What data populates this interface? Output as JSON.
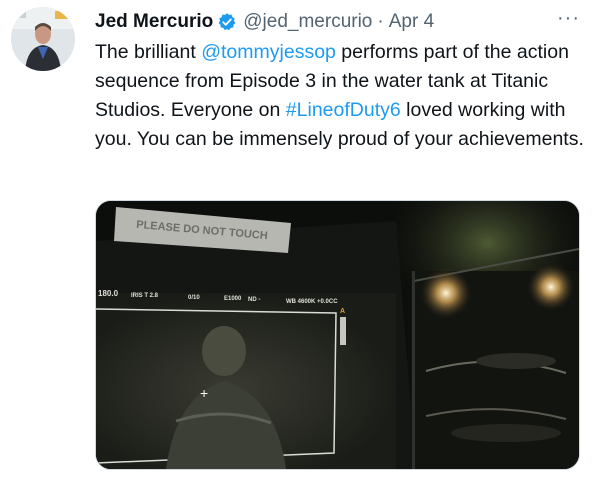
{
  "tweet": {
    "author_name": "Jed Mercurio",
    "handle": "@jed_mercurio",
    "separator": "·",
    "date": "Apr 4",
    "more_label": "···",
    "text_parts": {
      "p1": "The brilliant ",
      "mention": "@tommyjessop",
      "p2": " performs part of the action sequence from Episode 3 in the water tank at Titanic Studios. Everyone on ",
      "hashtag": "#LineofDuty6",
      "p3": " loved working with you. You can be immensely proud of your achievements."
    }
  },
  "media": {
    "sign_text": "PLEASE DO NOT TOUCH",
    "monitor_hud": {
      "shutter": "180.0",
      "iris": "IRIS T 2.8",
      "ratio": "0/10",
      "e_value": "E1000",
      "nd": "ND -",
      "wb": "WB 4600K +0.0CC",
      "mark": "A"
    }
  },
  "colors": {
    "link": "#1d9bf0",
    "verified": "#1d9bf0",
    "secondary_text": "#536471"
  },
  "icons": {
    "verified": "verified-badge-icon",
    "more": "more-options-icon"
  }
}
